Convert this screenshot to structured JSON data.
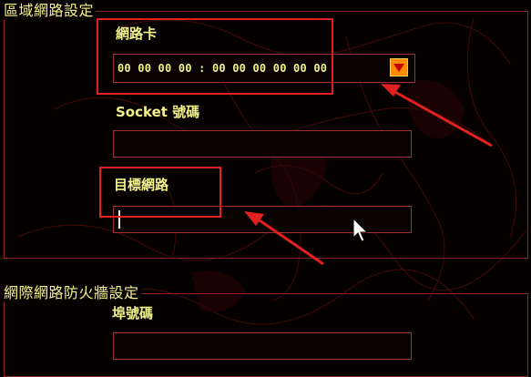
{
  "lan_section": {
    "title": "區域網路設定"
  },
  "adapter": {
    "label": "網路卡",
    "value": "00 00 00 00 : 00 00 00 00 00 00",
    "dropdown_icon": "chevron-down-icon"
  },
  "socket": {
    "label": "Socket 號碼",
    "value": ""
  },
  "target_network": {
    "label": "目標網路",
    "value": ""
  },
  "firewall_section": {
    "title": "網際網路防火牆設定"
  },
  "port": {
    "label": "埠號碼",
    "value": ""
  },
  "colors": {
    "text": "#f2f28a",
    "frame": "#8a2020",
    "highlight": "#e32020",
    "dropdown": "#ff8a00"
  }
}
